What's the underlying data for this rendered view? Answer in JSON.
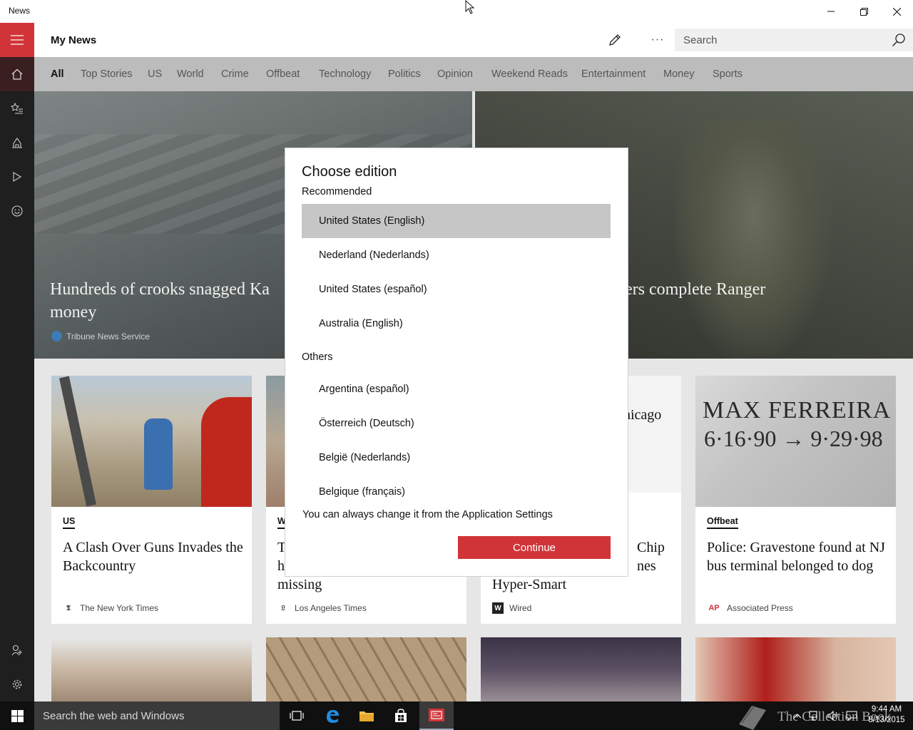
{
  "window": {
    "title": "News"
  },
  "header": {
    "page_title": "My News",
    "more_label": "···",
    "search_placeholder": "Search"
  },
  "tabs": [
    {
      "label": "All",
      "active": true
    },
    {
      "label": "Top Stories"
    },
    {
      "label": "US"
    },
    {
      "label": "World"
    },
    {
      "label": "Crime"
    },
    {
      "label": "Offbeat"
    },
    {
      "label": "Technology"
    },
    {
      "label": "Politics"
    },
    {
      "label": "Opinion"
    },
    {
      "label": "Weekend Reads"
    },
    {
      "label": "Entertainment"
    },
    {
      "label": "Money"
    },
    {
      "label": "Sports"
    }
  ],
  "hero": {
    "left": {
      "headline": "Hundreds of crooks snagged Ka",
      "headline_line2": "money",
      "source": "Tribune News Service"
    },
    "right": {
      "headline": "ers complete Ranger"
    }
  },
  "cards": [
    {
      "category": "US",
      "headline": "A Clash Over Guns Invades the Backcountry",
      "source": "The New York Times",
      "logo": "𝕿"
    },
    {
      "category": "W",
      "headline": "T\nh\nmissing",
      "headline_lines": [
        "T",
        "h",
        "missing"
      ],
      "source": "Los Angeles Times",
      "logo": "𝔏"
    },
    {
      "category": "",
      "headline_lines": [
        "Chip",
        "nes",
        "Hyper-Smart"
      ],
      "partial_top": "hicago",
      "source": "Wired",
      "logo": "W"
    },
    {
      "category": "Offbeat",
      "headline": "Police: Gravestone found at NJ bus terminal belonged to dog",
      "source": "Associated Press",
      "logo": "AP"
    }
  ],
  "gravestone": {
    "line1": "MAX FERREIRA",
    "line2": "6·16·90 → 9·29·98"
  },
  "dialog": {
    "title": "Choose edition",
    "recommended_label": "Recommended",
    "recommended": [
      {
        "label": "United States (English)",
        "selected": true
      },
      {
        "label": "Nederland (Nederlands)"
      },
      {
        "label": "United States (español)"
      },
      {
        "label": "Australia (English)"
      }
    ],
    "others_label": "Others",
    "others": [
      {
        "label": "Argentina (español)"
      },
      {
        "label": "Österreich (Deutsch)"
      },
      {
        "label": "België (Nederlands)"
      },
      {
        "label": "Belgique (français)"
      }
    ],
    "note": "You can always change it from the Application Settings",
    "continue_label": "Continue"
  },
  "taskbar": {
    "search_text": "Search the web and Windows",
    "time": "9:44 AM",
    "date": "8/13/2015",
    "watermark": "The Collection Book"
  },
  "colors": {
    "accent": "#d13438",
    "rail": "#1f1f1f",
    "tabs_bg": "#bcbcbc",
    "selected_option": "#c6c6c6"
  }
}
